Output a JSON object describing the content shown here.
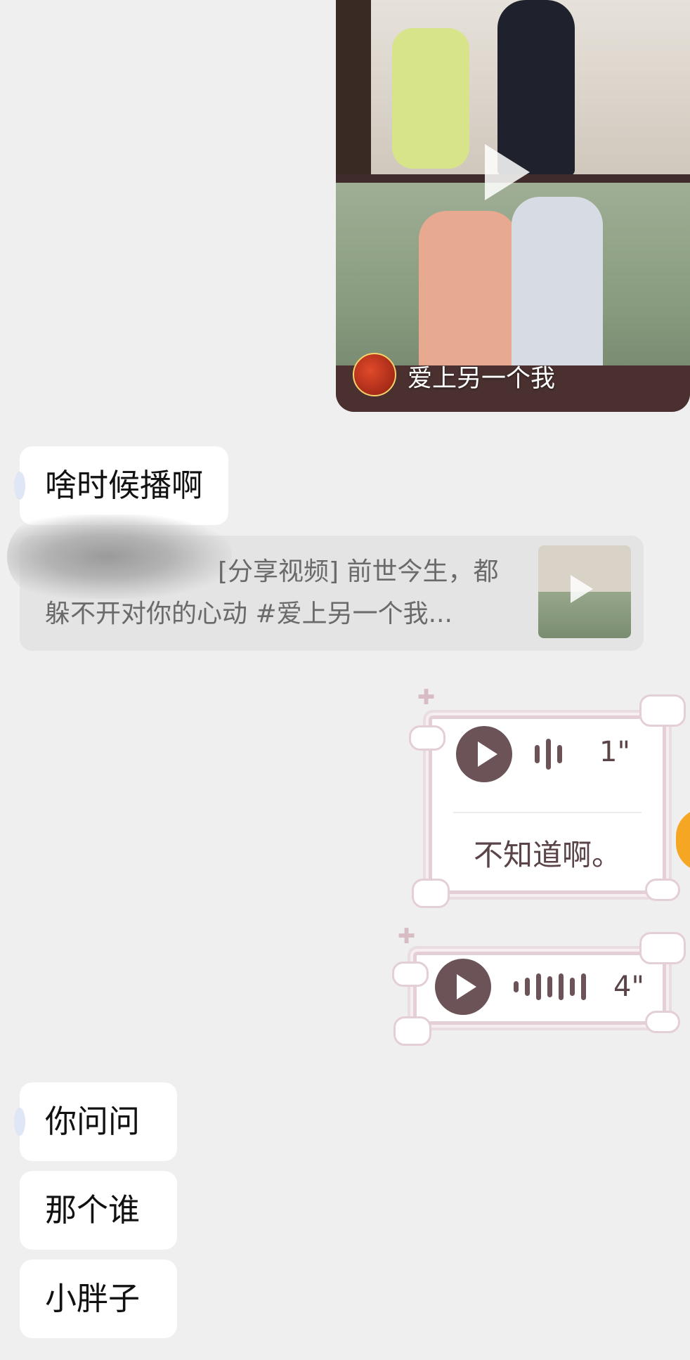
{
  "video_card": {
    "title": "爱上另一个我",
    "icons": [
      "play-icon",
      "logo-badge"
    ]
  },
  "messages": {
    "m1": "啥时候播啊",
    "share": {
      "line1": "[分享视频] 前世今生，都",
      "line2": "躲不开对你的心动 #爱上另一个我..."
    },
    "voice1": {
      "duration": "1\"",
      "transcript": "不知道啊。"
    },
    "voice2": {
      "duration": "4\""
    },
    "m2": "你问问",
    "m3": "那个谁",
    "m4": "小胖子"
  },
  "colors": {
    "background": "#efefef",
    "bubble": "#ffffff",
    "voice_accent": "#6b5357",
    "voice_border": "#e3cfd5"
  }
}
